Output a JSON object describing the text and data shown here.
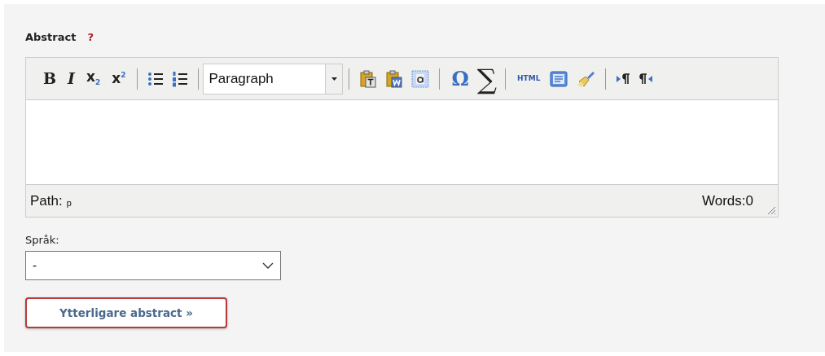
{
  "field": {
    "label": "Abstract",
    "help": "?"
  },
  "toolbar": [
    {
      "kind": "bold",
      "label": "B"
    },
    {
      "kind": "italic",
      "label": "I"
    },
    {
      "kind": "script",
      "label": "x$_{2}$"
    },
    {
      "kind": "script",
      "label": "x$^{2}$"
    },
    {
      "kind": "separator"
    },
    {
      "kind": "bullets"
    },
    {
      "kind": "numbering"
    },
    {
      "kind": "separator"
    },
    {
      "kind": "format",
      "value": "Paragraph"
    },
    {
      "kind": "separator"
    },
    {
      "kind": "pastetext"
    },
    {
      "kind": "pasteword"
    },
    {
      "kind": "selectall"
    },
    {
      "kind": "separator"
    },
    {
      "kind": "omega",
      "label": "Ω"
    },
    {
      "kind": "sigma",
      "label": "∑"
    },
    {
      "kind": "separator"
    },
    {
      "kind": "html",
      "label": "HTML"
    },
    {
      "kind": "template"
    },
    {
      "kind": "cleanup"
    },
    {
      "kind": "separator"
    },
    {
      "kind": "ltr"
    },
    {
      "kind": "rtl"
    }
  ],
  "status_bar": {
    "path_label": "Path:",
    "path": "p",
    "words": "Words:0"
  },
  "language": {
    "label": "Språk:",
    "value": "-"
  },
  "more_button": "Ytterligare abstract »"
}
